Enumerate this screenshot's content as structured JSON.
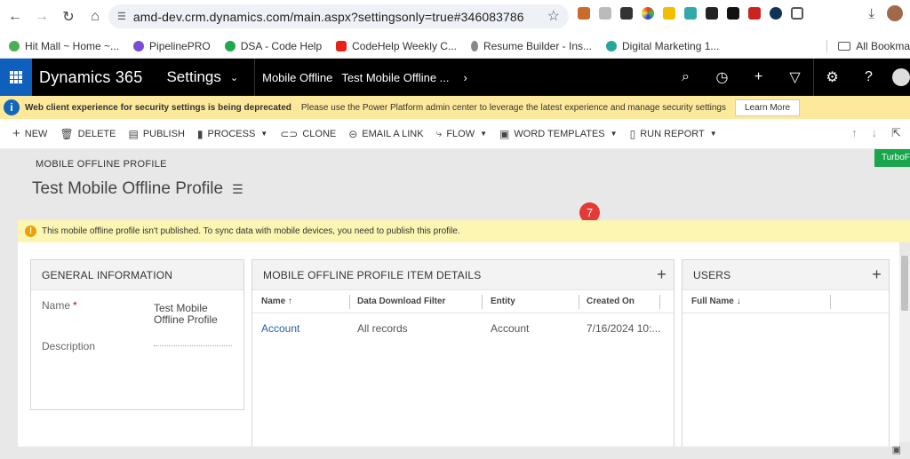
{
  "browser": {
    "url": "amd-dev.crm.dynamics.com/main.aspx?settingsonly=true#346083786",
    "bookmarks": [
      "Hit Mall ~ Home ~...",
      "PipelinePRO",
      "DSA - Code Help",
      "CodeHelp Weekly C...",
      "Resume Builder - Ins...",
      "Digital Marketing 1..."
    ],
    "all_bookmarks": "All Bookma"
  },
  "nav": {
    "brand": "Dynamics 365",
    "area": "Settings",
    "crumb1": "Mobile Offline",
    "crumb2": "Test Mobile Offline ...",
    "chevron": "›"
  },
  "notice": {
    "bold": "Web client experience for security settings is being deprecated",
    "text": "Please use the Power Platform admin center to leverage the latest experience and manage security settings",
    "button": "Learn More"
  },
  "commands": {
    "new": "NEW",
    "delete": "DELETE",
    "publish": "PUBLISH",
    "process": "PROCESS",
    "clone": "CLONE",
    "email_link": "EMAIL A LINK",
    "flow": "FLOW",
    "word_templates": "WORD TEMPLATES",
    "run_report": "RUN REPORT"
  },
  "record": {
    "entity": "MOBILE OFFLINE PROFILE",
    "title": "Test Mobile Offline Profile",
    "turbo": "TurboF"
  },
  "warning": "This mobile offline profile isn't published. To sync data with mobile devices, you need to publish this profile.",
  "general": {
    "header": "GENERAL INFORMATION",
    "name_label": "Name",
    "name_value": "Test Mobile Offline Profile",
    "description_label": "Description"
  },
  "items": {
    "header": "MOBILE OFFLINE PROFILE ITEM DETAILS",
    "columns": [
      "Name ↑",
      "Data Download Filter",
      "Entity",
      "Created On"
    ],
    "rows": [
      {
        "name": "Account",
        "filter": "All records",
        "entity": "Account",
        "created": "7/16/2024 10:..."
      }
    ]
  },
  "users": {
    "header": "USERS",
    "columns": [
      "Full Name ↓"
    ]
  },
  "annotation": {
    "badge": "7"
  },
  "colors": {
    "nav_bg": "#000000",
    "waffle": "#0f5fbd",
    "deprecation_bg": "#fde99b",
    "warning_bg": "#fdf6b2",
    "link": "#1f63ad",
    "badge": "#e53935",
    "turbo": "#19a54b"
  }
}
